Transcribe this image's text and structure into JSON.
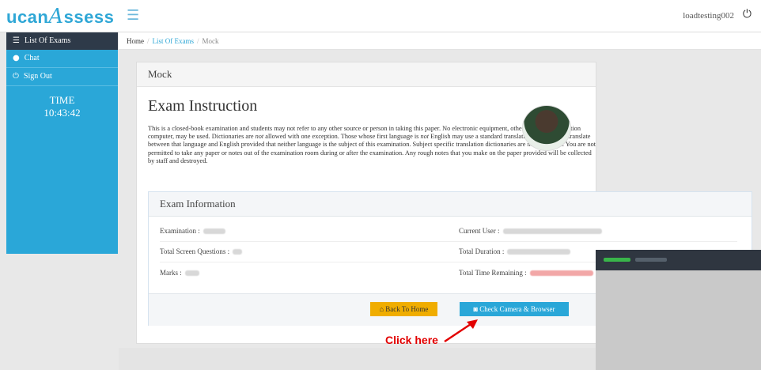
{
  "header": {
    "logo_prefix": "ucan",
    "logo_a": "A",
    "logo_suffix": "ssess",
    "menu_icon": "☰",
    "username": "loadtesting002",
    "power_icon": "⏻"
  },
  "sidebar": {
    "items": [
      {
        "icon": "☰",
        "label": "List Of Exams"
      },
      {
        "icon": "●",
        "label": "Chat"
      },
      {
        "icon": "⏻",
        "label": "Sign Out"
      }
    ],
    "time_label": "TIME",
    "time_value": "10:43:42"
  },
  "breadcrumb": {
    "home": "Home",
    "list": "List Of Exams",
    "current": "Mock"
  },
  "card": {
    "header": "Mock",
    "title": "Exam Instruction",
    "instruction_1": "This is a closed-book examination and students may not refer to any other source or person in taking this paper. No electronic equipment, other than the examination computer, may be used. Dictionaries are ",
    "instruction_not1": "not",
    "instruction_2": " allowed with one exception. Those whose first language is ",
    "instruction_not2": "not",
    "instruction_3": " English may use a standard translation dictionary to translate between that language and English provided that neither language is the subject of this examination. Subject specific translation dictionaries are not permitted. You are not permitted to take any paper or notes out of the examination room during or after the examination. Any rough notes that you make on the paper provided will be collected by staff and destroyed."
  },
  "exam_info": {
    "header": "Exam Information",
    "examination_label": "Examination :",
    "current_user_label": "Current User :",
    "total_questions_label": "Total Screen Questions :",
    "total_duration_label": "Total Duration :",
    "marks_label": "Marks :",
    "time_remaining_label": "Total Time Remaining :"
  },
  "buttons": {
    "back_home": "Back To Home",
    "back_home_icon": "⌂",
    "check_camera": "Check Camera & Browser",
    "camera_icon": "◙"
  },
  "annotation": {
    "click_here": "Click here"
  },
  "colors": {
    "accent": "#2aa7d8",
    "sidebar_active": "#2e3a49",
    "warning": "#f0ad00",
    "annotation_red": "#e20000"
  }
}
